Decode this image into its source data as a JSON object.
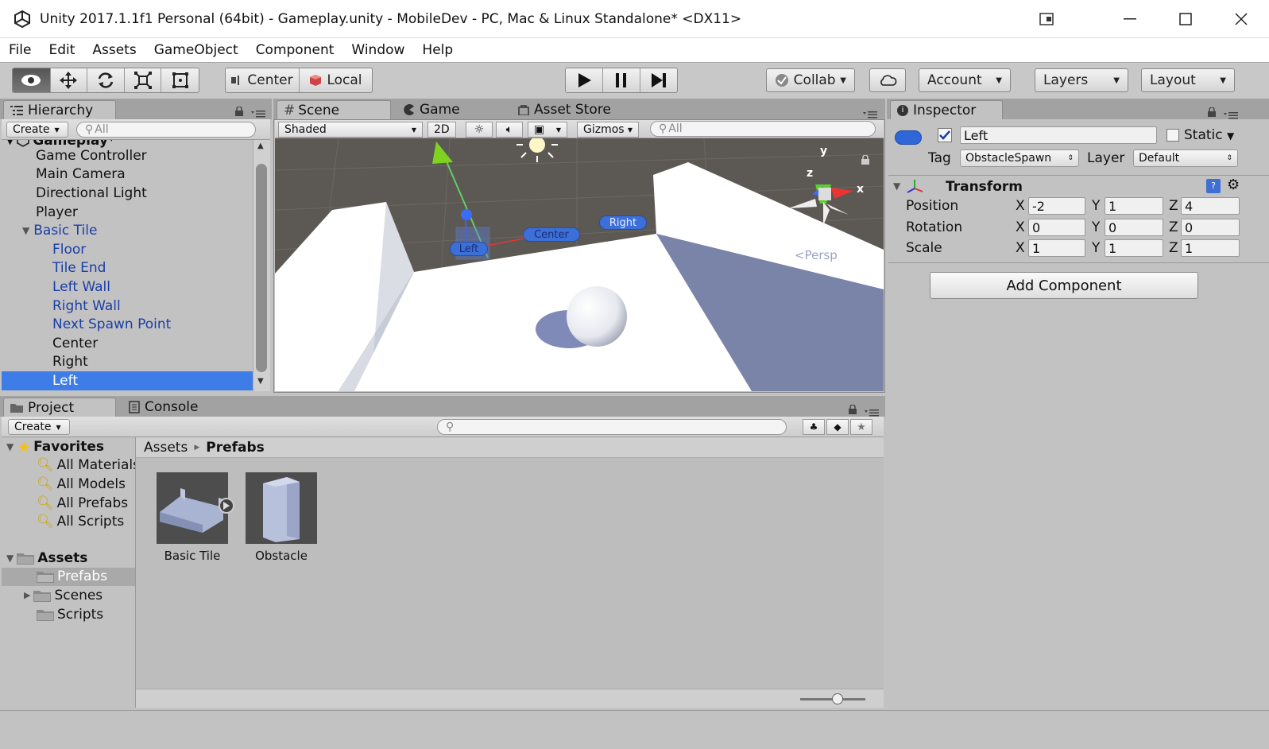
{
  "window": {
    "title": "Unity 2017.1.1f1 Personal (64bit) - Gameplay.unity - MobileDev - PC, Mac & Linux Standalone* <DX11>"
  },
  "menu": [
    "File",
    "Edit",
    "Assets",
    "GameObject",
    "Component",
    "Window",
    "Help"
  ],
  "toolbar": {
    "pivot": "Center",
    "space": "Local",
    "collab": "Collab",
    "account": "Account",
    "layers": "Layers",
    "layout": "Layout"
  },
  "hierarchy": {
    "tab": "Hierarchy",
    "create": "Create",
    "search_placeholder": "All",
    "scene": "Gameplay*",
    "items": [
      {
        "label": "Game Controller"
      },
      {
        "label": "Main Camera"
      },
      {
        "label": "Directional Light"
      },
      {
        "label": "Player"
      },
      {
        "label": "Basic Tile"
      },
      {
        "label": "Floor"
      },
      {
        "label": "Tile End"
      },
      {
        "label": "Left Wall"
      },
      {
        "label": "Right Wall"
      },
      {
        "label": "Next Spawn Point"
      },
      {
        "label": "Center"
      },
      {
        "label": "Right"
      },
      {
        "label": "Left"
      }
    ]
  },
  "scene": {
    "tabs": [
      "Scene",
      "Game",
      "Asset Store"
    ],
    "shading": "Shaded",
    "mode2d": "2D",
    "gizmos": "Gizmos",
    "search_placeholder": "All",
    "labels": {
      "left": "Left",
      "center": "Center",
      "right": "Right"
    },
    "persp": "Persp",
    "axes": {
      "x": "x",
      "y": "y",
      "z": "z"
    }
  },
  "project": {
    "tabs": [
      "Project",
      "Console"
    ],
    "create": "Create",
    "favorites": "Favorites",
    "fav_items": [
      "All Materials",
      "All Models",
      "All Prefabs",
      "All Scripts"
    ],
    "assets": "Assets",
    "asset_items": [
      "Prefabs",
      "Scenes",
      "Scripts"
    ],
    "breadcrumb": [
      "Assets",
      "Prefabs"
    ],
    "prefabs": [
      {
        "label": "Basic Tile"
      },
      {
        "label": "Obstacle"
      }
    ]
  },
  "inspector": {
    "tab": "Inspector",
    "name": "Left",
    "static": "Static",
    "tag_label": "Tag",
    "tag": "ObstacleSpawn",
    "layer_label": "Layer",
    "layer": "Default",
    "component": "Transform",
    "rows": [
      {
        "label": "Position",
        "x": "-2",
        "y": "1",
        "z": "4"
      },
      {
        "label": "Rotation",
        "x": "0",
        "y": "0",
        "z": "0"
      },
      {
        "label": "Scale",
        "x": "1",
        "y": "1",
        "z": "1"
      }
    ],
    "axis_x": "X",
    "axis_y": "Y",
    "axis_z": "Z",
    "add_component": "Add Component"
  }
}
